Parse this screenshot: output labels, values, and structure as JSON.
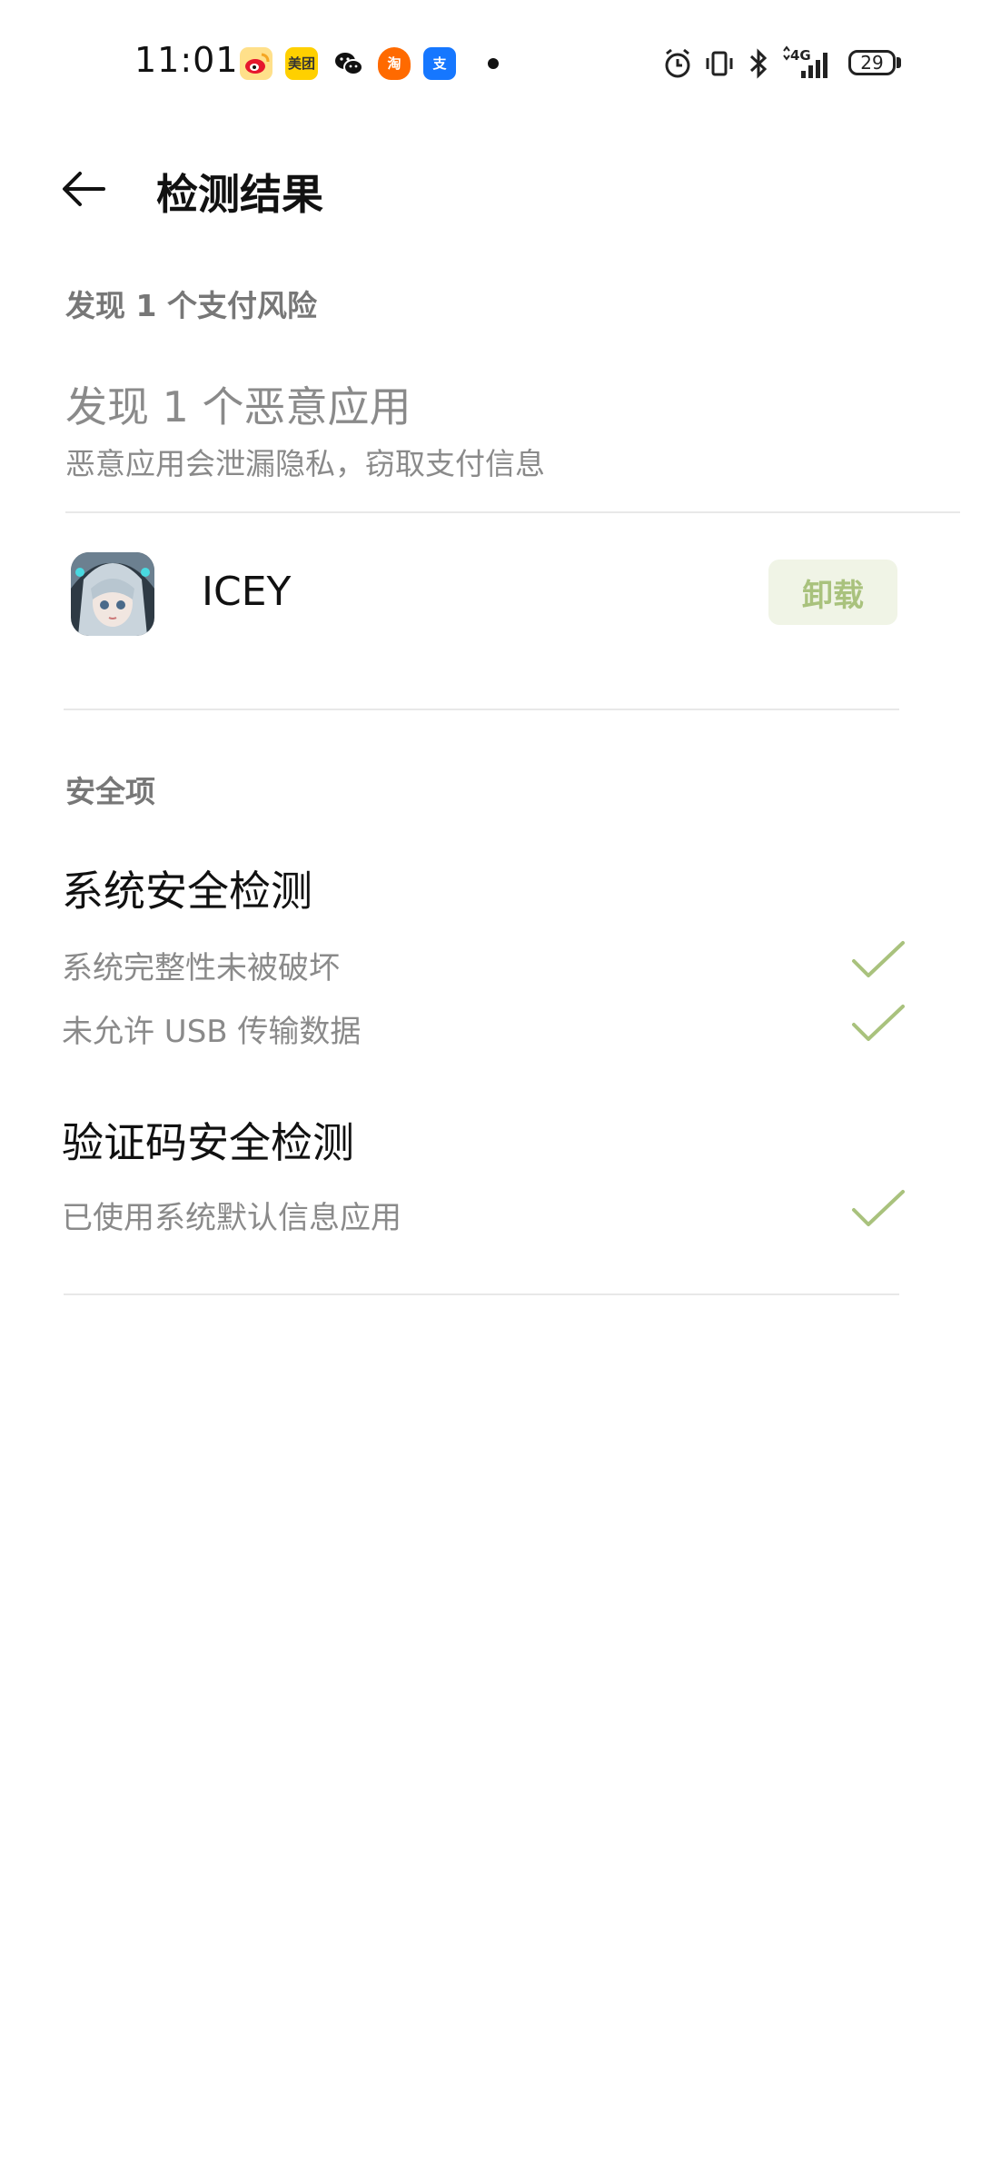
{
  "status_bar": {
    "time": "11:01",
    "notification_icons": [
      "weibo-icon",
      "meituan-icon",
      "wechat-icon",
      "taobao-icon",
      "alipay-icon"
    ],
    "meituan_label": "美团",
    "taobao_label": "淘",
    "alipay_label": "支",
    "network": "4G",
    "battery": "29"
  },
  "header": {
    "title": "检测结果"
  },
  "payment_risk": {
    "section_label": "发现 1 个支付风险",
    "headline": "发现 1 个恶意应用",
    "description": "恶意应用会泄漏隐私，窃取支付信息",
    "app": {
      "name": "ICEY",
      "uninstall_label": "卸载"
    }
  },
  "security": {
    "section_label": "安全项",
    "groups": [
      {
        "title": "系统安全检测",
        "items": [
          "系统完整性未被破坏",
          "未允许 USB 传输数据"
        ]
      },
      {
        "title": "验证码安全检测",
        "items": [
          "已使用系统默认信息应用"
        ]
      }
    ]
  },
  "colors": {
    "accent_green": "#a9c27d",
    "button_bg": "#f0f4e6",
    "gray_text": "#8a8a8a"
  }
}
